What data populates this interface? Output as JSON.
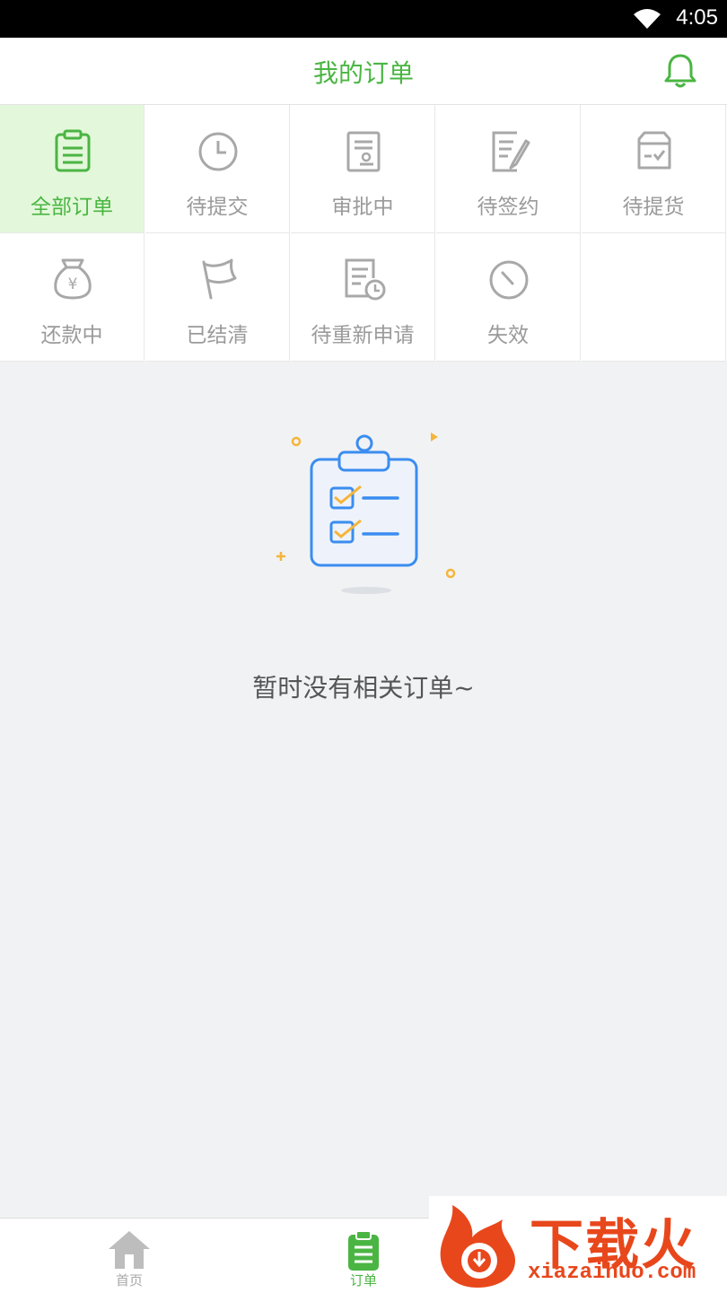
{
  "status_bar": {
    "time": "4:05"
  },
  "header": {
    "title": "我的订单"
  },
  "categories": [
    {
      "label": "全部订单",
      "icon": "clipboard-icon",
      "active": true
    },
    {
      "label": "待提交",
      "icon": "clock-icon"
    },
    {
      "label": "审批中",
      "icon": "approval-doc-icon"
    },
    {
      "label": "待签约",
      "icon": "sign-doc-icon"
    },
    {
      "label": "待提货",
      "icon": "pickup-box-icon"
    },
    {
      "label": "还款中",
      "icon": "money-bag-icon"
    },
    {
      "label": "已结清",
      "icon": "flag-icon"
    },
    {
      "label": "待重新申请",
      "icon": "doc-clock-icon"
    },
    {
      "label": "失效",
      "icon": "expired-icon"
    }
  ],
  "empty_state": {
    "message": "暂时没有相关订单~"
  },
  "tabbar": {
    "home_label": "首页",
    "orders_label": "订单"
  },
  "watermark": {
    "brand": "下载火",
    "url": "xiazaihuo.com"
  },
  "colors": {
    "accent": "#4bb543",
    "active_bg": "#e3f8da",
    "inactive_icon": "#a8a8a8"
  }
}
